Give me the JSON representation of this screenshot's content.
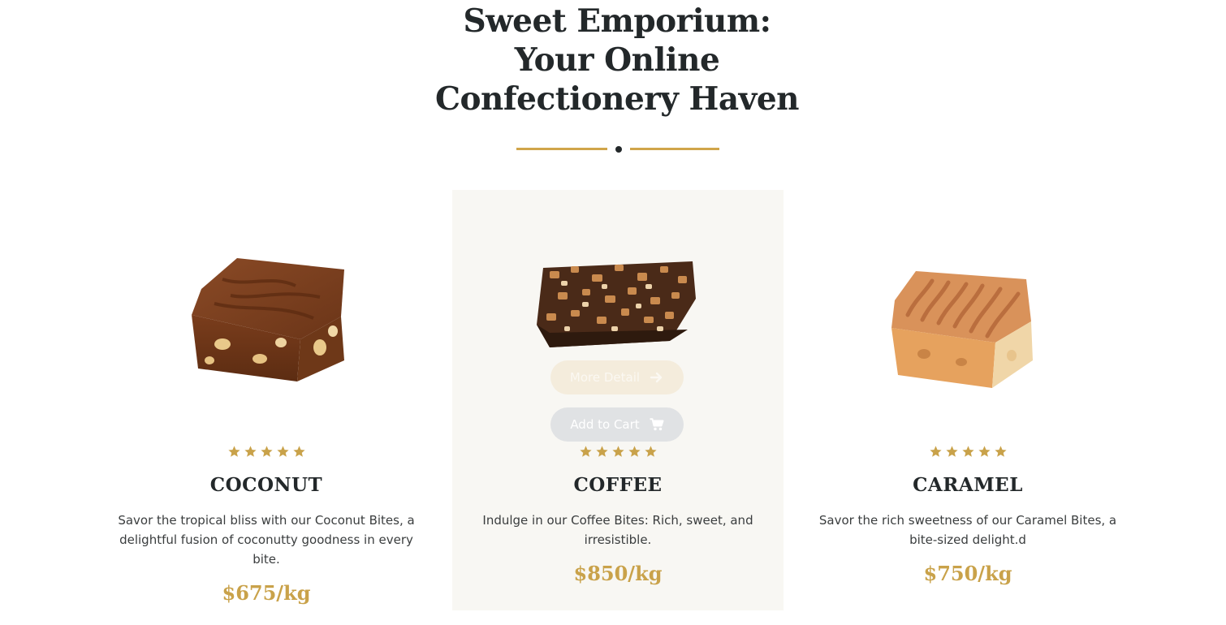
{
  "page": {
    "title": "Sweet Emporium: Your Online Confectionery Haven"
  },
  "colors": {
    "accent": "#d0a54a",
    "text_dark": "#23282a",
    "star": "#c9a24a",
    "card_highlight_bg": "#f8f7f3"
  },
  "products": [
    {
      "name": "COCONUT",
      "rating": 5,
      "description": "Savor the tropical bliss with our Coconut Bites, a delightful fusion of coconutty goodness in every bite.",
      "price": "$675/kg",
      "image_icon": "chocolate-fudge-image"
    },
    {
      "name": "COFFEE",
      "rating": 5,
      "description": "Indulge in our Coffee Bites: Rich, sweet, and irresistible.",
      "price": "$850/kg",
      "image_icon": "nut-brittle-image",
      "more_detail_label": "More Detail",
      "add_to_cart_label": "Add to Cart"
    },
    {
      "name": "CARAMEL",
      "rating": 5,
      "description": "Savor the rich sweetness of our Caramel Bites, a bite-sized delight.d",
      "price": "$750/kg",
      "image_icon": "caramel-fudge-image"
    }
  ]
}
